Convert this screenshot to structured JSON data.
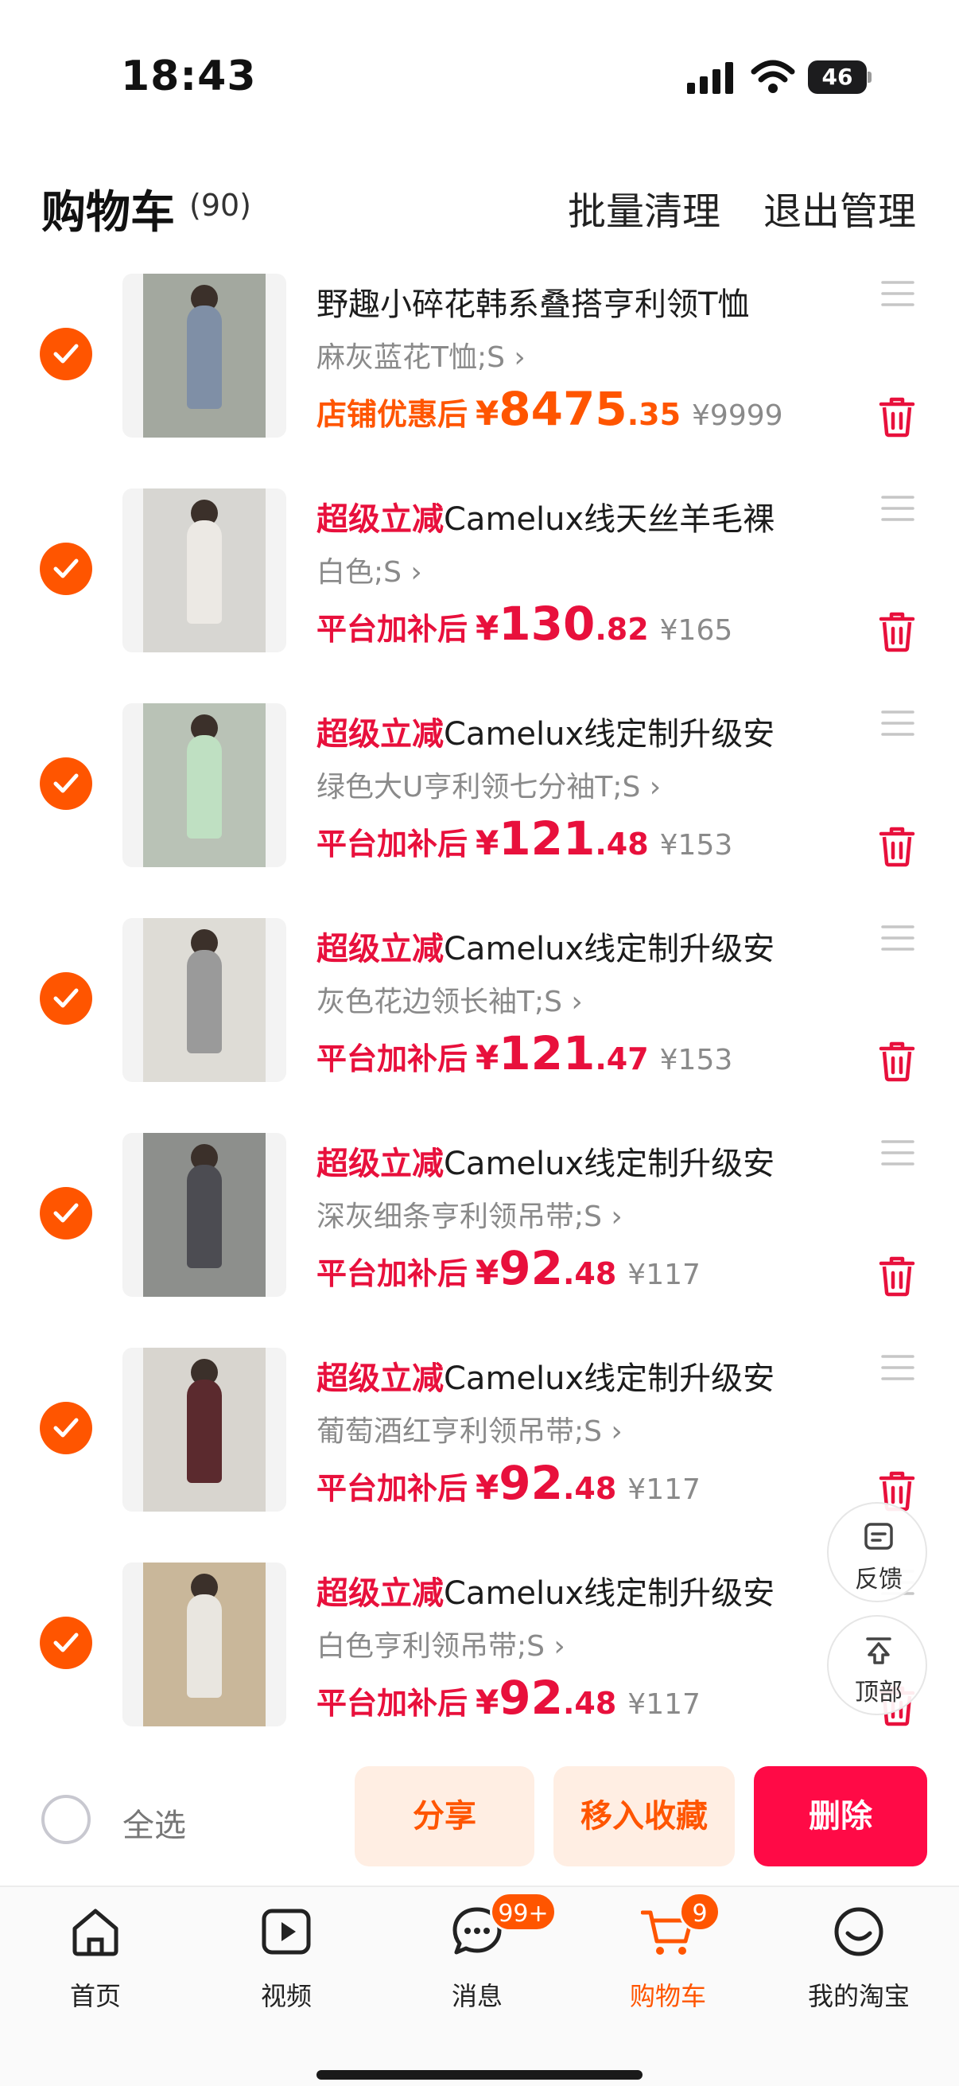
{
  "status_bar": {
    "time": "18:43",
    "battery": "46"
  },
  "header": {
    "title": "购物车",
    "count": "(90)",
    "batch_clean": "批量清理",
    "exit_manage": "退出管理"
  },
  "items": [
    {
      "tag": "",
      "name": "野趣小碎花韩系叠搭亨利领T恤",
      "sku": "麻灰蓝花T恤;S",
      "price_label": "店铺优惠后",
      "currency": "¥",
      "price_int": "8475",
      "price_dec": ".35",
      "orig": "¥9999",
      "accent": "orange",
      "photo_color": "#a3a89f",
      "figure_color": "#7f8fa6"
    },
    {
      "tag": "超级立减",
      "name": "Camelux线天丝羊毛裸",
      "sku": "白色;S",
      "price_label": "平台加补后",
      "currency": "¥",
      "price_int": "130",
      "price_dec": ".82",
      "orig": "¥165",
      "accent": "red",
      "photo_color": "#d7d6d2",
      "figure_color": "#ece9e4"
    },
    {
      "tag": "超级立减",
      "name": "Camelux线定制升级安",
      "sku": "绿色大U亨利领七分袖T;S",
      "price_label": "平台加补后",
      "currency": "¥",
      "price_int": "121",
      "price_dec": ".48",
      "orig": "¥153",
      "accent": "red",
      "photo_color": "#b9c2b6",
      "figure_color": "#bfe0c2"
    },
    {
      "tag": "超级立减",
      "name": "Camelux线定制升级安",
      "sku": "灰色花边领长袖T;S",
      "price_label": "平台加补后",
      "currency": "¥",
      "price_int": "121",
      "price_dec": ".47",
      "orig": "¥153",
      "accent": "red",
      "photo_color": "#dedcd6",
      "figure_color": "#9a9a9a"
    },
    {
      "tag": "超级立减",
      "name": "Camelux线定制升级安",
      "sku": "深灰细条亨利领吊带;S",
      "price_label": "平台加补后",
      "currency": "¥",
      "price_int": "92",
      "price_dec": ".48",
      "orig": "¥117",
      "accent": "red",
      "photo_color": "#8d8f8c",
      "figure_color": "#4c4c52"
    },
    {
      "tag": "超级立减",
      "name": "Camelux线定制升级安",
      "sku": "葡萄酒红亨利领吊带;S",
      "price_label": "平台加补后",
      "currency": "¥",
      "price_int": "92",
      "price_dec": ".48",
      "orig": "¥117",
      "accent": "red",
      "photo_color": "#d8d5cf",
      "figure_color": "#5b2a2e"
    },
    {
      "tag": "超级立减",
      "name": "Camelux线定制升级安",
      "sku": "白色亨利领吊带;S",
      "price_label": "平台加补后",
      "currency": "¥",
      "price_int": "92",
      "price_dec": ".48",
      "orig": "¥117",
      "accent": "red",
      "photo_color": "#c9b79a",
      "figure_color": "#e9e6e0"
    }
  ],
  "floating": {
    "feedback": "反馈",
    "top": "顶部"
  },
  "action_bar": {
    "select_all": "全选",
    "share": "分享",
    "move_to_favorites": "移入收藏",
    "delete": "删除"
  },
  "tab_bar": {
    "tabs": [
      {
        "label": "首页",
        "icon": "home-icon"
      },
      {
        "label": "视频",
        "icon": "video-icon"
      },
      {
        "label": "消息",
        "icon": "message-icon",
        "badge": "99+"
      },
      {
        "label": "购物车",
        "icon": "cart-icon",
        "badge": "9",
        "active": true
      },
      {
        "label": "我的淘宝",
        "icon": "profile-icon"
      }
    ]
  },
  "colors": {
    "accent_orange": "#ff5500",
    "accent_red": "#e8103c",
    "delete_button": "#ff0a46"
  }
}
